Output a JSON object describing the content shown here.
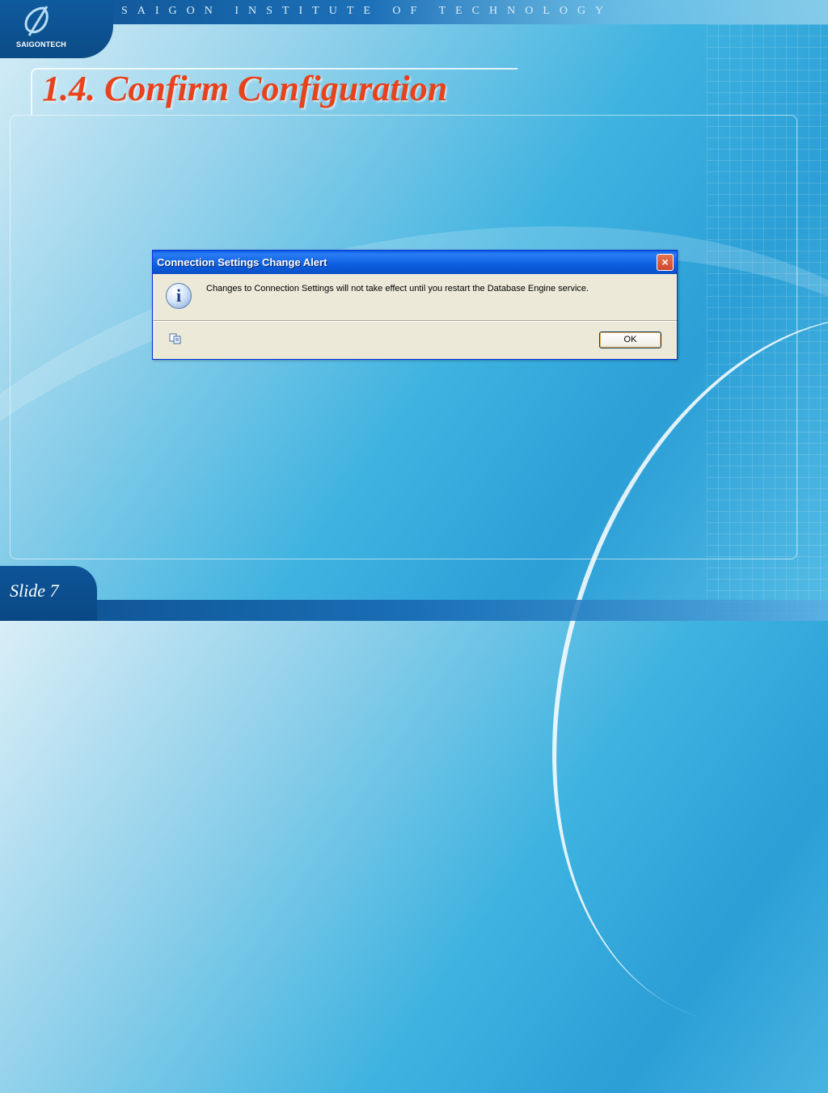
{
  "header": {
    "logo_text": "SAIGONTECH",
    "institute": "SAIGON INSTITUTE OF TECHNOLOGY"
  },
  "slide": {
    "title": "1.4. Confirm Configuration",
    "footer": "Slide 7"
  },
  "dialog": {
    "title": "Connection Settings Change Alert",
    "close_label": "×",
    "message": "Changes to Connection Settings will not take effect until you restart the Database Engine service.",
    "ok_label": "OK",
    "info_glyph": "i"
  },
  "colors": {
    "title": "#e8421c",
    "titlebar": "#0c5fe0",
    "dialog_bg": "#ece9d8"
  }
}
